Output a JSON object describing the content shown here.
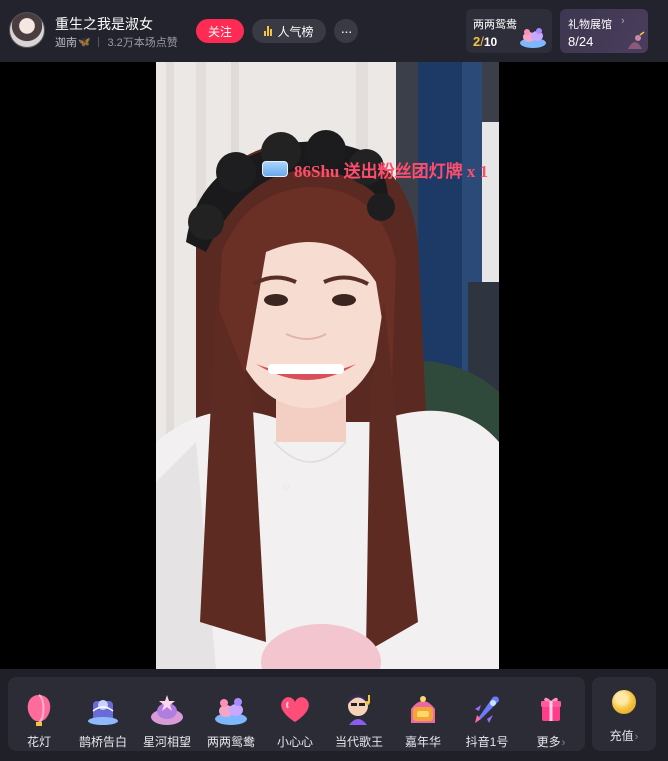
{
  "header": {
    "streamer_name": "重生之我是淑女",
    "handle": "迦南",
    "likes_text": "3.2万本场点赞",
    "follow_label": "关注",
    "rank_label": "人气榜",
    "more_label": "···"
  },
  "task_card": {
    "title": "两两鸳鸯",
    "current": "2",
    "slash": "/",
    "total": "10"
  },
  "gallery_card": {
    "title": "礼物展馆",
    "chevron": "›",
    "count": "8/24"
  },
  "video": {
    "gift_banner": "86Shu 送出粉丝团灯牌 x 1"
  },
  "gifts": [
    {
      "label": "花灯",
      "icon": "lantern-icon"
    },
    {
      "label": "鹊桥告白",
      "icon": "magpie-bridge-icon"
    },
    {
      "label": "星河相望",
      "icon": "star-river-icon"
    },
    {
      "label": "两两鸳鸯",
      "icon": "mandarin-duck-icon"
    },
    {
      "label": "小心心",
      "icon": "heart-icon"
    },
    {
      "label": "当代歌王",
      "icon": "singer-icon"
    },
    {
      "label": "嘉年华",
      "icon": "carnival-icon"
    },
    {
      "label": "抖音1号",
      "icon": "rocket-icon"
    },
    {
      "label": "更多",
      "icon": "gift-box-icon"
    }
  ],
  "recharge": {
    "label": "充值",
    "icon": "coin-icon"
  },
  "colors": {
    "accent": "#fe2c55",
    "banner_text": "#ff4d6d",
    "gold": "#f5c542",
    "header_bg": "#23232d"
  }
}
